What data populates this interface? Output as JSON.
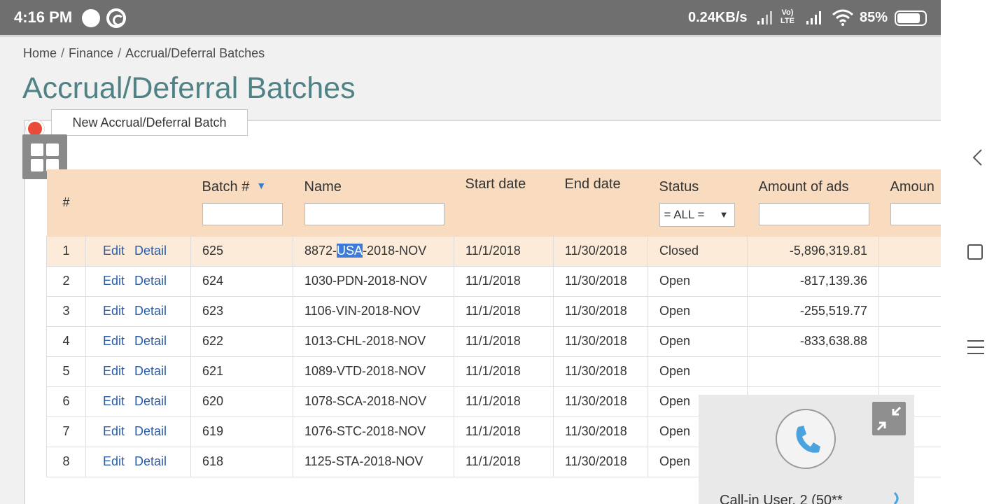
{
  "statusbar": {
    "time": "4:16 PM",
    "net_speed": "0.24KB/s",
    "volte": "Vo) LTE",
    "battery": "85%",
    "battery_level": 0.85
  },
  "breadcrumb": {
    "items": [
      "Home",
      "Finance",
      "Accrual/Deferral Batches"
    ],
    "separator": "/"
  },
  "page_title": "Accrual/Deferral Batches",
  "new_batch_button": "New Accrual/Deferral Batch",
  "table": {
    "headers": {
      "hash": "#",
      "batch": "Batch #",
      "name": "Name",
      "start": "Start date",
      "end": "End date",
      "status": "Status",
      "amount_ads": "Amount of ads",
      "amount_cut": "Amoun"
    },
    "status_filter": "= ALL =",
    "sort_indicator": "▼",
    "edit_label": "Edit",
    "detail_label": "Detail",
    "selected_text": "USA",
    "rows": [
      {
        "n": "1",
        "batch": "625",
        "name": "8872-USA-2018-NOV",
        "start": "11/1/2018",
        "end": "11/30/2018",
        "status": "Closed",
        "amount": "-5,896,319.81"
      },
      {
        "n": "2",
        "batch": "624",
        "name": "1030-PDN-2018-NOV",
        "start": "11/1/2018",
        "end": "11/30/2018",
        "status": "Open",
        "amount": "-817,139.36"
      },
      {
        "n": "3",
        "batch": "623",
        "name": "1106-VIN-2018-NOV",
        "start": "11/1/2018",
        "end": "11/30/2018",
        "status": "Open",
        "amount": "-255,519.77"
      },
      {
        "n": "4",
        "batch": "622",
        "name": "1013-CHL-2018-NOV",
        "start": "11/1/2018",
        "end": "11/30/2018",
        "status": "Open",
        "amount": "-833,638.88"
      },
      {
        "n": "5",
        "batch": "621",
        "name": "1089-VTD-2018-NOV",
        "start": "11/1/2018",
        "end": "11/30/2018",
        "status": "Open",
        "amount": ""
      },
      {
        "n": "6",
        "batch": "620",
        "name": "1078-SCA-2018-NOV",
        "start": "11/1/2018",
        "end": "11/30/2018",
        "status": "Open",
        "amount": ""
      },
      {
        "n": "7",
        "batch": "619",
        "name": "1076-STC-2018-NOV",
        "start": "11/1/2018",
        "end": "11/30/2018",
        "status": "Open",
        "amount": ""
      },
      {
        "n": "8",
        "batch": "618",
        "name": "1125-STA-2018-NOV",
        "start": "11/1/2018",
        "end": "11/30/2018",
        "status": "Open",
        "amount": ""
      }
    ]
  },
  "call_widget": {
    "label": "Call-in User, 2 (50**"
  },
  "colors": {
    "title": "#4f8285",
    "header_bg": "#f9dcc0",
    "highlight_row": "#fcebd9",
    "link": "#2a5da8",
    "phone": "#4aa3df",
    "record_dot": "#e84b3a"
  }
}
